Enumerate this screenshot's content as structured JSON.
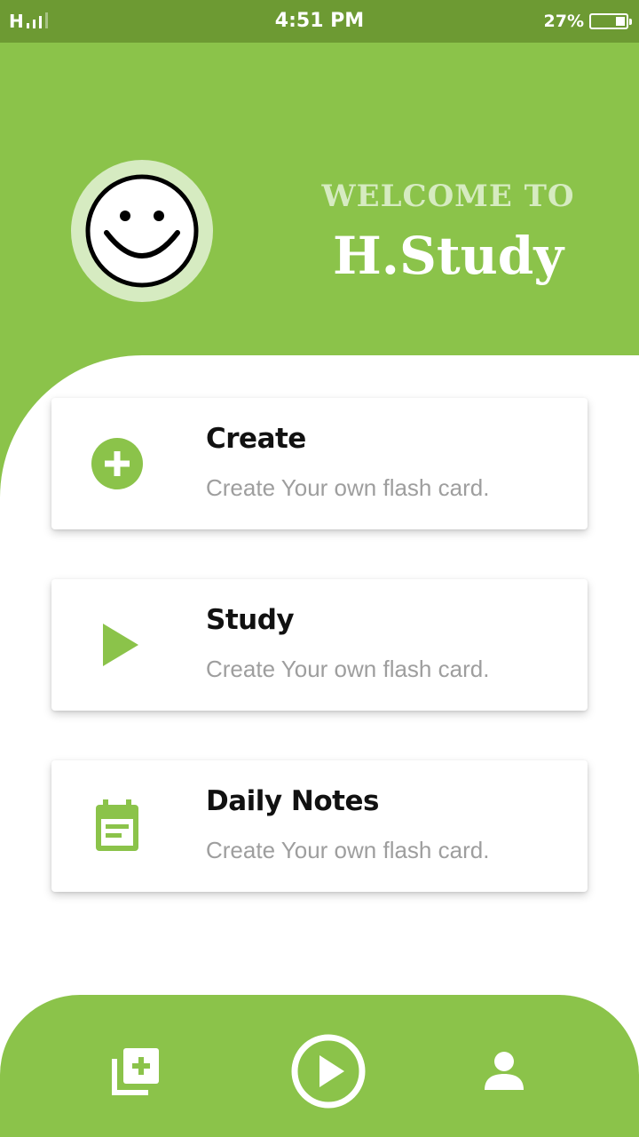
{
  "status_bar": {
    "signal_label": "H",
    "time": "4:51 PM",
    "battery_percent": "27%",
    "battery_level": 0.27
  },
  "header": {
    "welcome_line": "WELCOME TO",
    "app_name": "H.Study",
    "avatar_icon": "smiley-face-icon"
  },
  "cards": [
    {
      "icon": "add-circle-icon",
      "title": "Create",
      "subtitle": "Create Your own flash card."
    },
    {
      "icon": "play-icon",
      "title": "Study",
      "subtitle": "Create Your own flash card."
    },
    {
      "icon": "calendar-notes-icon",
      "title": "Daily Notes",
      "subtitle": "Create Your own flash card."
    }
  ],
  "bottom_nav": {
    "items": [
      {
        "icon": "library-add-icon"
      },
      {
        "icon": "play-circle-icon"
      },
      {
        "icon": "person-icon"
      }
    ]
  },
  "colors": {
    "primary": "#8bc34a",
    "primary_dark": "#6d9a33",
    "primary_light": "#d6ebc1",
    "text_dark": "#111111",
    "text_muted": "#9e9e9e"
  }
}
